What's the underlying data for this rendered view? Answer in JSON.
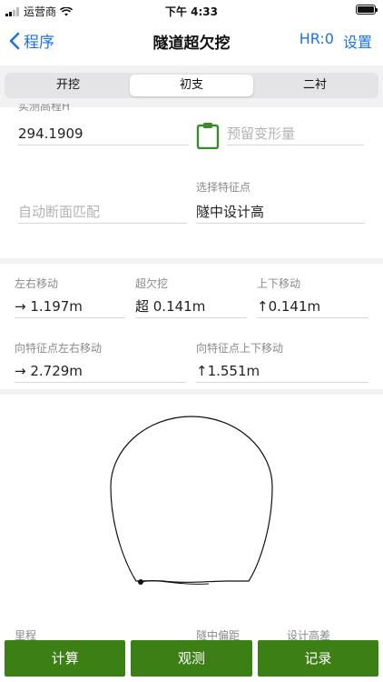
{
  "status": {
    "carrier": "运营商",
    "time": "下午 4:33"
  },
  "nav": {
    "back_label": "程序",
    "title": "隧道超欠挖",
    "hr_label": "HR:0",
    "settings_label": "设置"
  },
  "tabs": [
    {
      "label": "开挖",
      "active": false
    },
    {
      "label": "初支",
      "active": true
    },
    {
      "label": "二衬",
      "active": false
    }
  ],
  "form": {
    "measured_mileage_label": "实测高程H",
    "measured_mileage_value": "294.1909",
    "reserved_deformation_placeholder": "预留变形量",
    "auto_section_placeholder": "自动断面匹配",
    "feature_point_label": "选择特征点",
    "feature_point_value": "隧中设计高"
  },
  "results": {
    "lr_move_label": "左右移动",
    "lr_move_value": "→ 1.197m",
    "over_under_label": "超欠挖",
    "over_under_value": "超 0.141m",
    "ud_move_label": "上下移动",
    "ud_move_value": "↑0.141m",
    "fp_lr_label": "向特征点左右移动",
    "fp_lr_value": "→ 2.729m",
    "fp_ud_label": "向特征点上下移动",
    "fp_ud_value": "↑1.551m"
  },
  "bottom_labels": {
    "mileage": "里程",
    "offset": "隧中偏距",
    "design_diff": "设计高差"
  },
  "buttons": {
    "calc": "计算",
    "observe": "观测",
    "record": "记录"
  },
  "colors": {
    "accent": "#1a73e8",
    "button": "#3c7f14",
    "clipboard": "#3c8a2e"
  }
}
